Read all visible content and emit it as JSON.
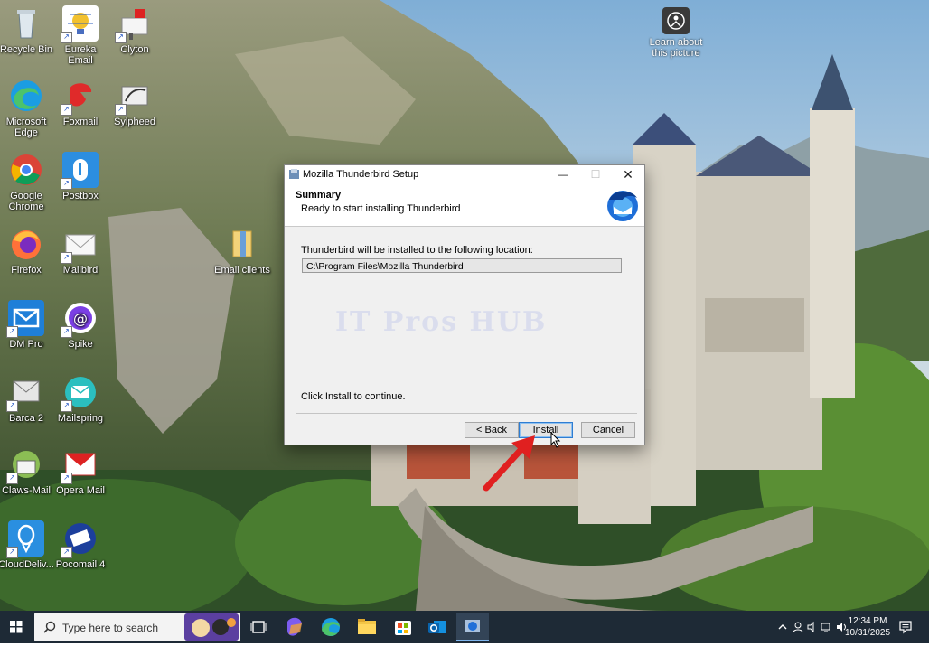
{
  "desktop": {
    "icons": [
      {
        "label": "Recycle Bin",
        "icon": "recycle-bin-icon"
      },
      {
        "label": "Eureka Email",
        "icon": "eureka-email-icon"
      },
      {
        "label": "Clyton",
        "icon": "clyton-icon"
      },
      {
        "label": "Microsoft Edge",
        "icon": "edge-icon"
      },
      {
        "label": "Foxmail",
        "icon": "foxmail-icon"
      },
      {
        "label": "Sylpheed",
        "icon": "sylpheed-icon"
      },
      {
        "label": "Google Chrome",
        "icon": "chrome-icon"
      },
      {
        "label": "Postbox",
        "icon": "postbox-icon"
      },
      {
        "label": "Firefox",
        "icon": "firefox-icon"
      },
      {
        "label": "Mailbird",
        "icon": "mailbird-icon"
      },
      {
        "label": "Email clients",
        "icon": "folder-icon"
      },
      {
        "label": "DM Pro",
        "icon": "dmpro-icon"
      },
      {
        "label": "Spike",
        "icon": "spike-icon"
      },
      {
        "label": "Barca 2",
        "icon": "barca-icon"
      },
      {
        "label": "Mailspring",
        "icon": "mailspring-icon"
      },
      {
        "label": "Claws-Mail",
        "icon": "claws-mail-icon"
      },
      {
        "label": "Opera Mail",
        "icon": "opera-mail-icon"
      },
      {
        "label": "CloudDeliv...",
        "icon": "clouddelivery-icon"
      },
      {
        "label": "Pocomail 4",
        "icon": "pocomail-icon"
      }
    ],
    "learn_about": "Learn about this picture"
  },
  "dialog": {
    "title": "Mozilla Thunderbird Setup",
    "header_title": "Summary",
    "header_subtitle": "Ready to start installing Thunderbird",
    "location_label": "Thunderbird will be installed to the following location:",
    "install_path": "C:\\Program Files\\Mozilla Thunderbird",
    "watermark": "IT Pros HUB",
    "instruction": "Click Install to continue.",
    "buttons": {
      "back": "< Back",
      "install": "Install",
      "cancel": "Cancel"
    }
  },
  "taskbar": {
    "search_placeholder": "Type here to search",
    "time": "12:34 PM",
    "date": "10/31/2025"
  },
  "colors": {
    "taskbar": "#1e2a36",
    "accent": "#2f7dd2",
    "arrow": "#e02020"
  }
}
